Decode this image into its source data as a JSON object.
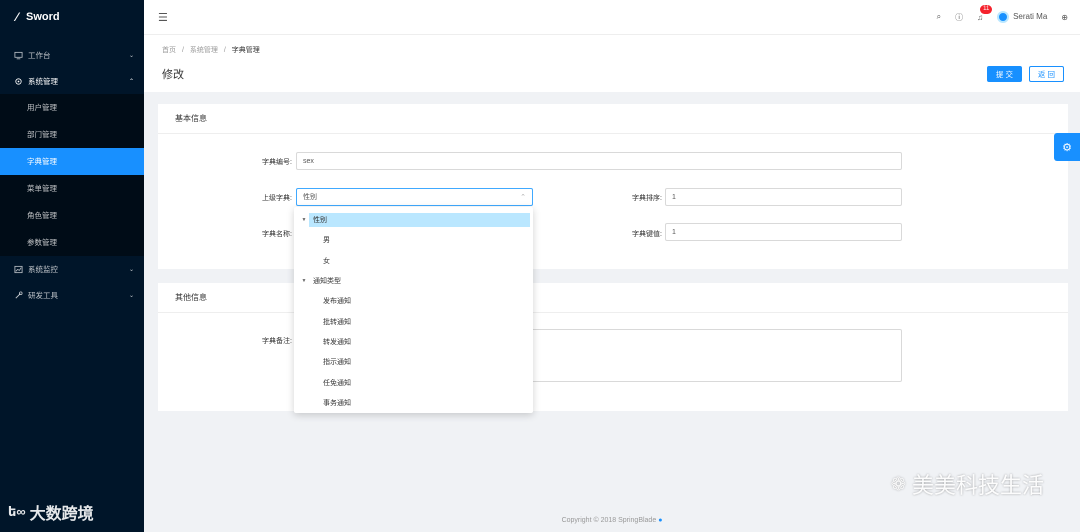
{
  "app": {
    "name": "Sword"
  },
  "sidebar": {
    "groups": [
      {
        "label": "工作台"
      },
      {
        "label": "系统管理"
      },
      {
        "label": "系统监控"
      },
      {
        "label": "研发工具"
      }
    ],
    "sub_items": [
      "用户管理",
      "部门管理",
      "字典管理",
      "菜单管理",
      "角色管理",
      "参数管理"
    ],
    "watermark": "大数跨境"
  },
  "header": {
    "badge_count": "11",
    "username": "Serati Ma"
  },
  "breadcrumb": {
    "items": [
      "首页",
      "系统管理",
      "字典管理"
    ],
    "sep": "/"
  },
  "page": {
    "title": "修改",
    "submit_label": "提 交",
    "back_label": "返 回"
  },
  "card1": {
    "title": "基本信息",
    "fields": {
      "code_label": "字典编号:",
      "code_value": "sex",
      "parent_label": "上级字典:",
      "parent_value": "性别",
      "sort_label": "字典排序:",
      "sort_value": "1",
      "name_label": "字典名称:",
      "key_label": "字典键值:",
      "key_value": "1"
    }
  },
  "card2": {
    "title": "其他信息",
    "remark_label": "字典备注:"
  },
  "dropdown": {
    "nodes": [
      {
        "label": "性别",
        "level": 0
      },
      {
        "label": "男",
        "level": 1
      },
      {
        "label": "女",
        "level": 1
      },
      {
        "label": "通知类型",
        "level": 0
      },
      {
        "label": "发布通知",
        "level": 1
      },
      {
        "label": "批转通知",
        "level": 1
      },
      {
        "label": "转发通知",
        "level": 1
      },
      {
        "label": "指示通知",
        "level": 1
      },
      {
        "label": "任免通知",
        "level": 1
      },
      {
        "label": "事务通知",
        "level": 1
      }
    ]
  },
  "footer": {
    "text": "Copyright © 2018 SpringBlade"
  },
  "watermark": "美美科技生活",
  "colors": {
    "sidebar_bg": "#001529",
    "primary": "#1890ff"
  }
}
